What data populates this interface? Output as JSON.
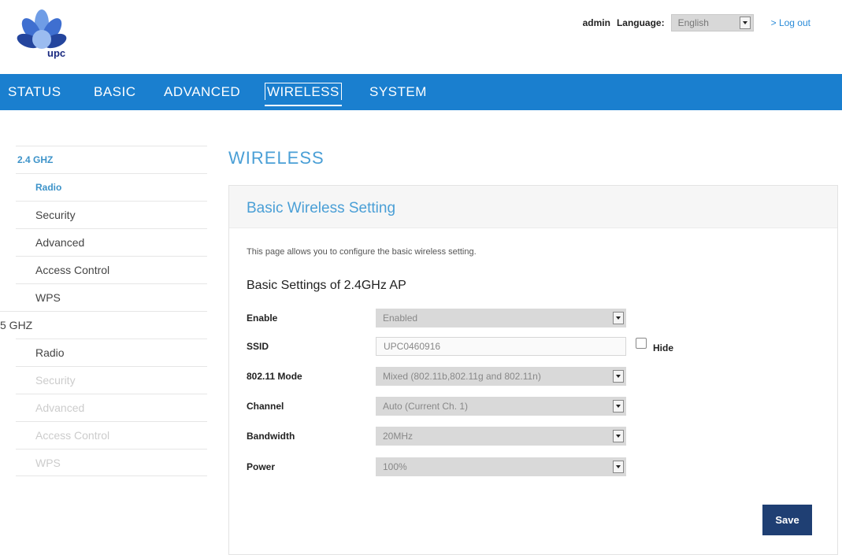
{
  "header": {
    "logo_text": "upc",
    "user": "admin",
    "language_label": "Language:",
    "language_value": "English",
    "logout": "> Log out"
  },
  "nav": {
    "items": [
      {
        "label": "STATUS"
      },
      {
        "label": "BASIC"
      },
      {
        "label": "ADVANCED"
      },
      {
        "label": "WIRELESS",
        "active": true
      },
      {
        "label": "SYSTEM"
      }
    ]
  },
  "sidebar": {
    "items": [
      {
        "label": "2.4 GHZ",
        "kind": "section",
        "state": "active"
      },
      {
        "label": "Radio",
        "kind": "item",
        "state": "active"
      },
      {
        "label": "Security",
        "kind": "item"
      },
      {
        "label": "Advanced",
        "kind": "item"
      },
      {
        "label": "Access Control",
        "kind": "item"
      },
      {
        "label": "WPS",
        "kind": "item"
      },
      {
        "label": "5 GHZ",
        "kind": "section"
      },
      {
        "label": "Radio",
        "kind": "item"
      },
      {
        "label": "Security",
        "kind": "item",
        "state": "disabled"
      },
      {
        "label": "Advanced",
        "kind": "item",
        "state": "disabled"
      },
      {
        "label": "Access Control",
        "kind": "item",
        "state": "disabled"
      },
      {
        "label": "WPS",
        "kind": "item",
        "state": "disabled"
      }
    ]
  },
  "main": {
    "page_title": "WIRELESS",
    "panel_title": "Basic Wireless Setting",
    "description": "This page allows you to configure the basic wireless setting.",
    "section_title": "Basic Settings of 2.4GHz AP",
    "fields": {
      "enable": {
        "label": "Enable",
        "value": "Enabled"
      },
      "ssid": {
        "label": "SSID",
        "value": "UPC0460916",
        "hide_label": "Hide",
        "hide_checked": false
      },
      "mode": {
        "label": "802.11 Mode",
        "value": "Mixed (802.11b,802.11g and 802.11n)"
      },
      "channel": {
        "label": "Channel",
        "value": "Auto (Current Ch. 1)"
      },
      "bandwidth": {
        "label": "Bandwidth",
        "value": "20MHz"
      },
      "power": {
        "label": "Power",
        "value": "100%"
      }
    },
    "save_label": "Save"
  },
  "colors": {
    "nav_bg": "#1a7fcf",
    "accent_text": "#4a9fd6",
    "save_button": "#1f3f73"
  }
}
